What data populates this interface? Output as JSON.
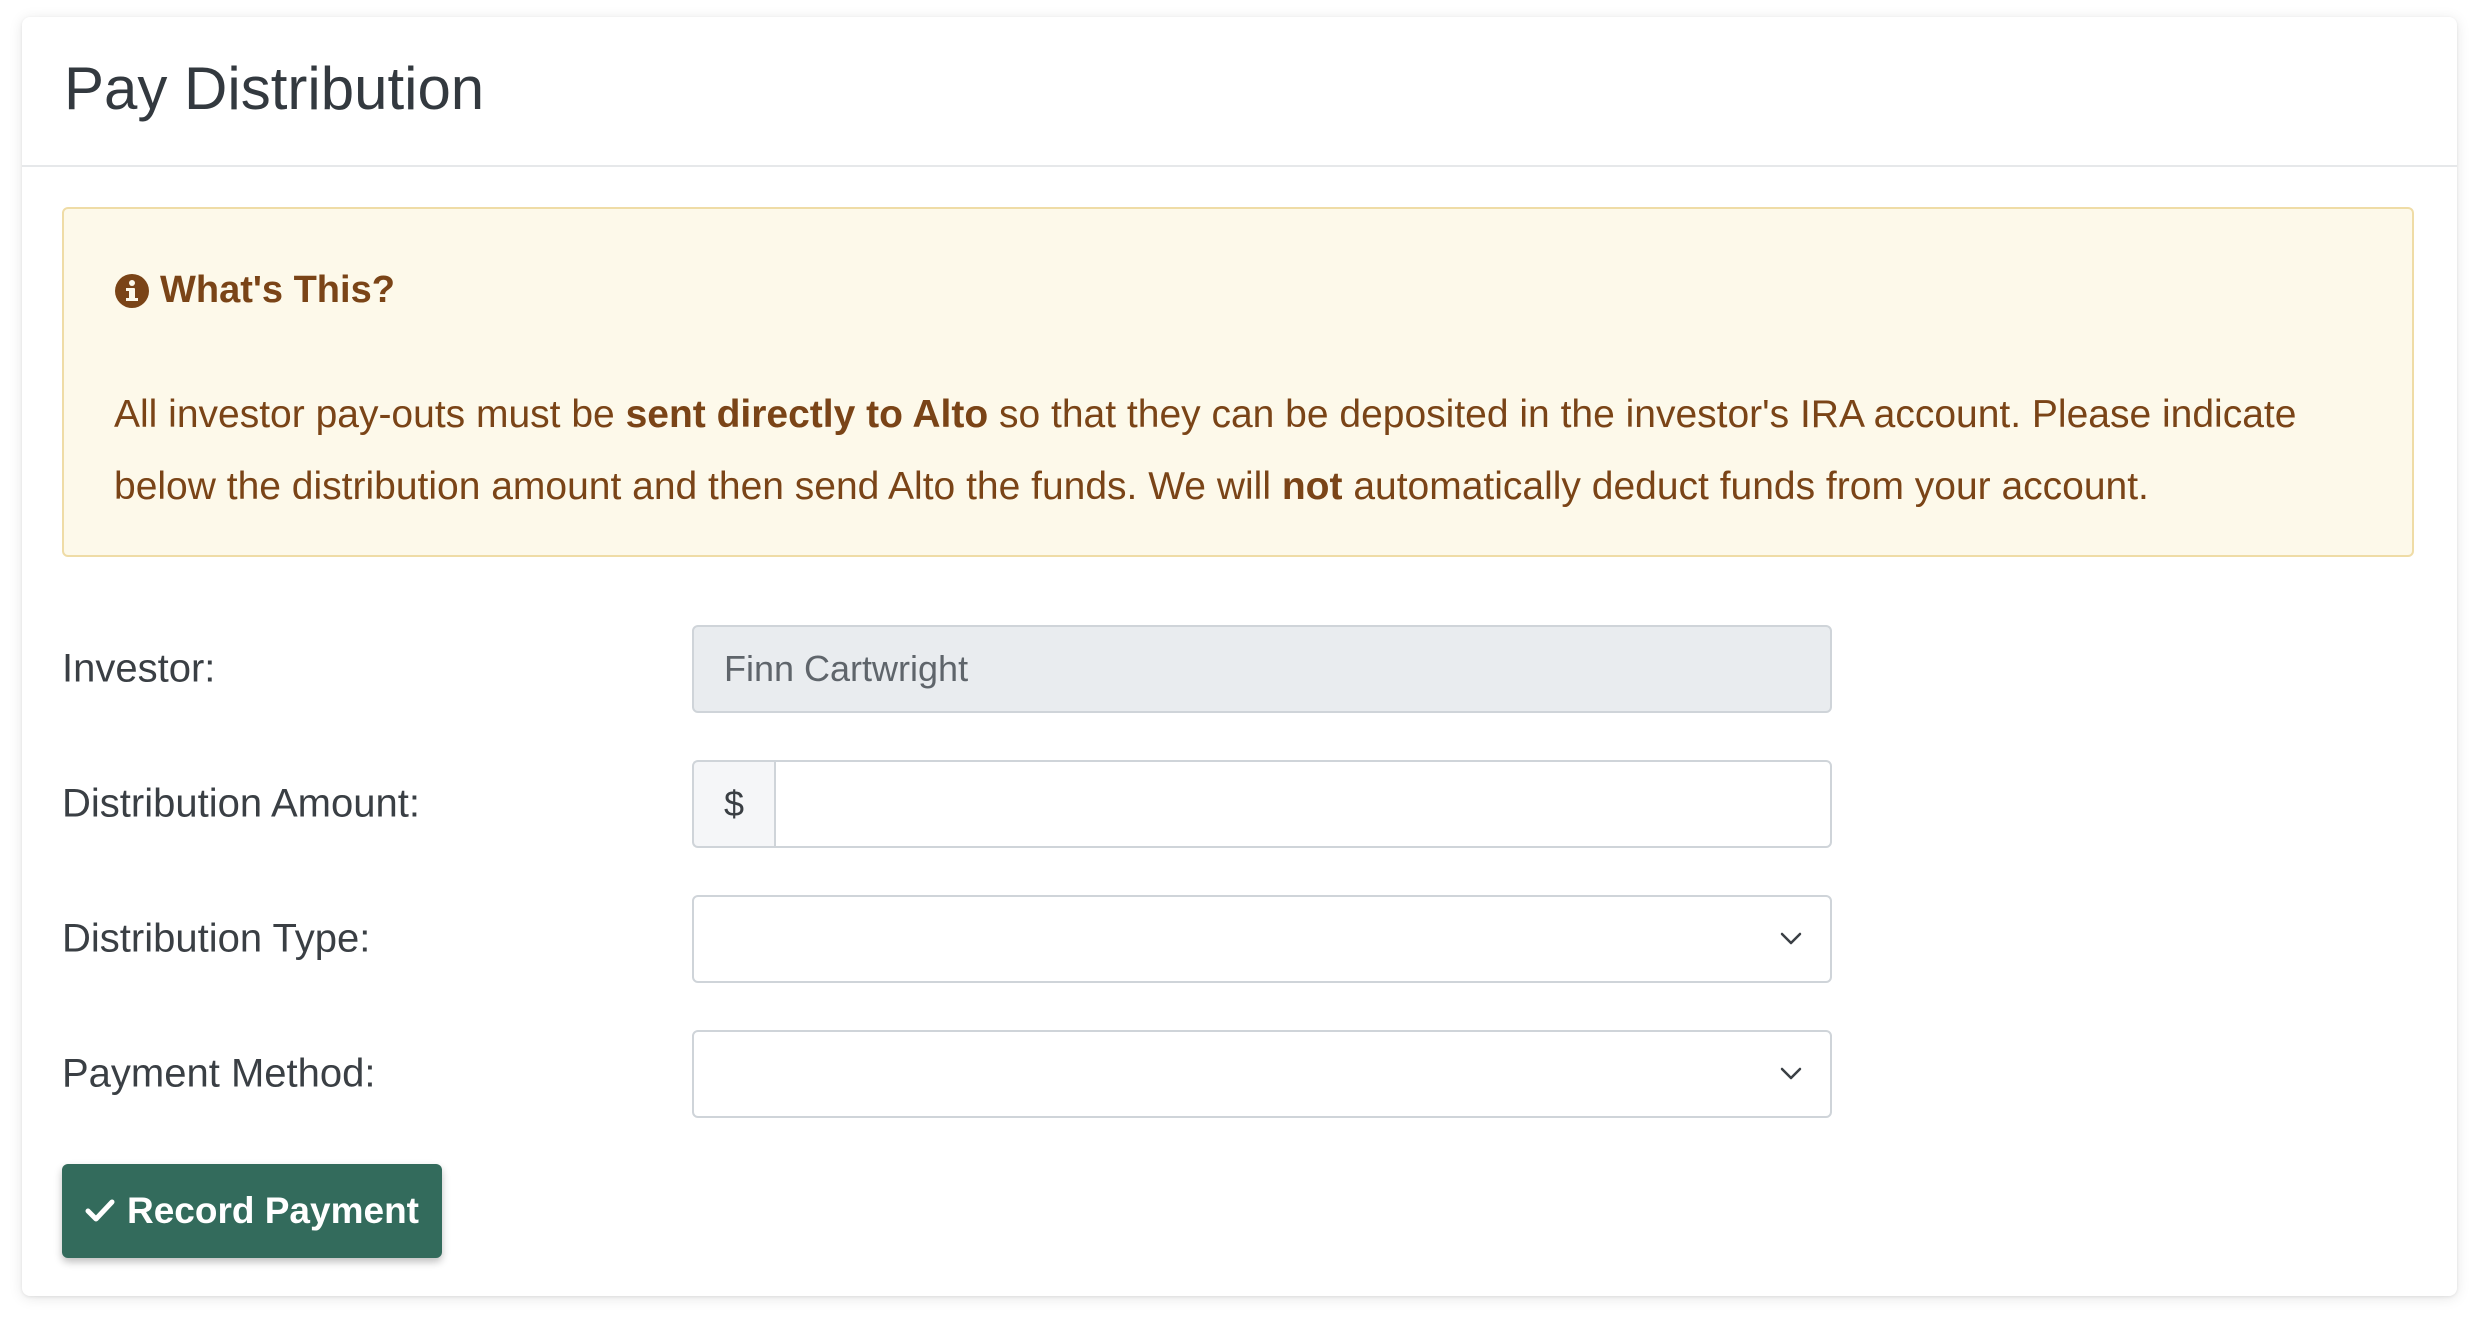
{
  "page": {
    "title": "Pay Distribution"
  },
  "alert": {
    "heading": "What's This?",
    "icon": "info-circle-icon",
    "body_part1": "All investor pay-outs must be ",
    "body_bold1": "sent directly to Alto",
    "body_part2": " so that they can be deposited in the investor's IRA account. Please indicate below the distribution amount and then send Alto the funds. We will ",
    "body_bold2": "not",
    "body_part3": " automatically deduct funds from your account."
  },
  "form": {
    "investor": {
      "label": "Investor:",
      "value": "Finn Cartwright"
    },
    "amount": {
      "label": "Distribution Amount:",
      "prefix": "$",
      "value": ""
    },
    "type": {
      "label": "Distribution Type:",
      "value": ""
    },
    "method": {
      "label": "Payment Method:",
      "value": ""
    }
  },
  "submit": {
    "label": "Record Payment",
    "icon": "check-icon"
  },
  "colors": {
    "alert_bg": "#fdf9ea",
    "alert_text": "#7a4417",
    "button_bg": "#336b5c",
    "readonly_bg": "#e9ecef"
  }
}
